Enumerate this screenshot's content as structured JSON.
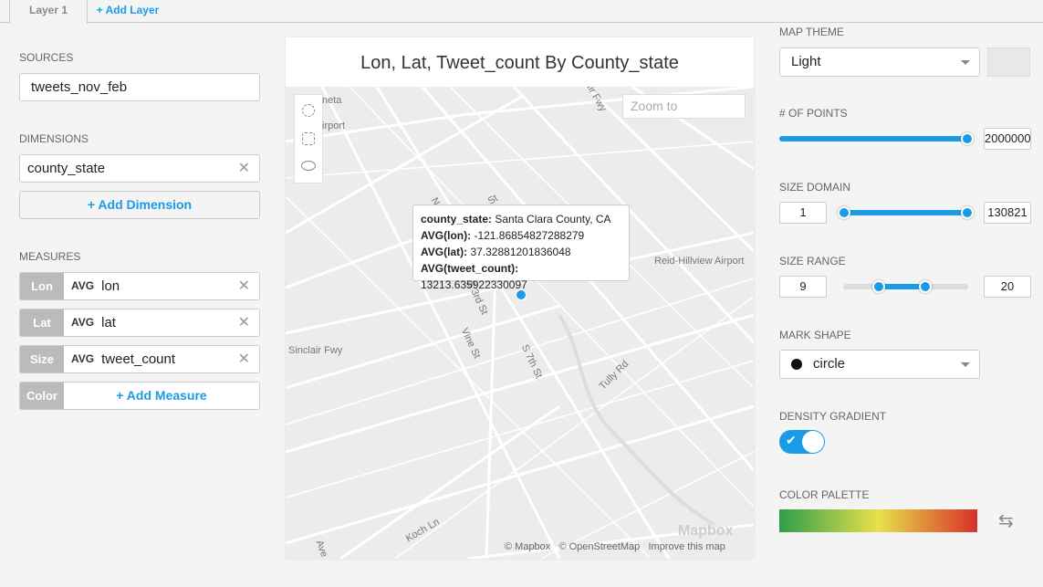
{
  "tabs": {
    "layer1": "Layer 1",
    "add_layer": "+ Add Layer"
  },
  "sources": {
    "label": "SOURCES",
    "value": "tweets_nov_feb"
  },
  "dimensions": {
    "label": "DIMENSIONS",
    "value": "county_state",
    "add": "+ Add Dimension"
  },
  "measures": {
    "label": "MEASURES",
    "items": [
      {
        "tag": "Lon",
        "agg": "AVG",
        "field": "lon"
      },
      {
        "tag": "Lat",
        "agg": "AVG",
        "field": "lat"
      },
      {
        "tag": "Size",
        "agg": "AVG",
        "field": "tweet_count"
      }
    ],
    "color_tag": "Color",
    "add": "+ Add Measure"
  },
  "chart": {
    "title": "Lon,  Lat,  Tweet_count By County_state",
    "zoom_placeholder": "Zoom to",
    "map_labels": [
      "neta",
      "irport",
      "Reid-Hillview Airport",
      "Sinclair Fwy",
      "S 3rd St",
      "Vine St",
      "S 7th St",
      "Tully Rd",
      "Koch Ln",
      "N",
      "St",
      "Ave",
      "air Fwy"
    ],
    "tooltip": [
      {
        "k": "county_state:",
        "v": " Santa Clara County, CA"
      },
      {
        "k": "AVG(lon):",
        "v": " -121.86854827288279"
      },
      {
        "k": "AVG(lat):",
        "v": " 37.32881201836048"
      },
      {
        "k": "AVG(tweet_count):",
        "v": " 13213.635922330097"
      }
    ],
    "mapbox_logo": "Mapbox",
    "attribution": {
      "mapbox": "© Mapbox",
      "osm": "© OpenStreetMap",
      "improve": "Improve this map"
    }
  },
  "settings": {
    "map_theme": {
      "label": "MAP THEME",
      "value": "Light"
    },
    "points": {
      "label": "# OF POINTS",
      "value": "2000000",
      "fraction": 1.0
    },
    "size_domain": {
      "label": "SIZE DOMAIN",
      "min": "1",
      "max": "130821"
    },
    "size_range": {
      "label": "SIZE RANGE",
      "min": "9",
      "max": "20"
    },
    "mark_shape": {
      "label": "MARK SHAPE",
      "value": "circle"
    },
    "density": {
      "label": "DENSITY GRADIENT",
      "on": true
    },
    "palette": {
      "label": "COLOR PALETTE",
      "colors": [
        "#2e9e4a",
        "#e8e04a",
        "#d7302a"
      ]
    }
  },
  "colors": {
    "accent": "#1a9be8"
  }
}
